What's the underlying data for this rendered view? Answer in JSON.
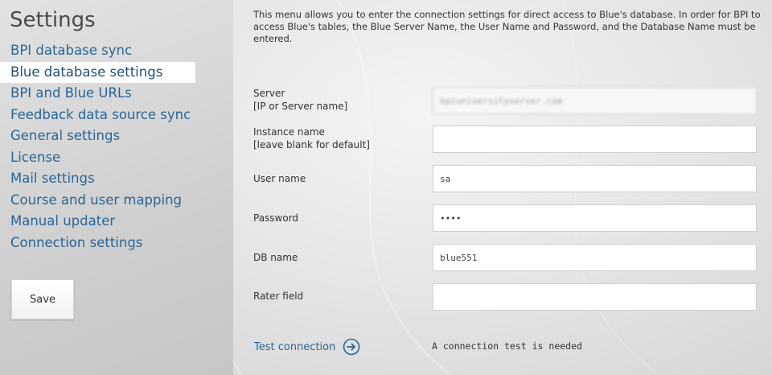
{
  "sidebar": {
    "title": "Settings",
    "items": [
      {
        "label": "BPI database sync"
      },
      {
        "label": "Blue database settings",
        "active": true
      },
      {
        "label": "BPI and Blue URLs"
      },
      {
        "label": "Feedback data source sync"
      },
      {
        "label": "General settings"
      },
      {
        "label": "License"
      },
      {
        "label": "Mail settings"
      },
      {
        "label": "Course and user mapping"
      },
      {
        "label": "Manual updater"
      },
      {
        "label": "Connection settings"
      }
    ],
    "save_label": "Save"
  },
  "description": "This menu allows you to enter the connection settings for direct access to Blue's database. In order for BPI to access Blue's tables, the Blue Server Name, the User Name and Password, and the Database Name must be entered.",
  "form": {
    "server": {
      "label": "Server",
      "hint": "[IP or Server name]",
      "value": "bpiuniversityserver.com"
    },
    "instance": {
      "label": "Instance name",
      "hint": "[leave blank for default]",
      "value": ""
    },
    "username": {
      "label": "User name",
      "value": "sa"
    },
    "password": {
      "label": "Password",
      "value": "••••"
    },
    "dbname": {
      "label": "DB name",
      "value": "blue551"
    },
    "rater": {
      "label": "Rater field",
      "value": ""
    }
  },
  "test": {
    "link_label": "Test connection",
    "status": "A connection test is needed"
  },
  "icons": {
    "arrow": "arrow-right-circle-icon"
  },
  "colors": {
    "link": "#2a6597",
    "active_bg": "#ffffff"
  }
}
